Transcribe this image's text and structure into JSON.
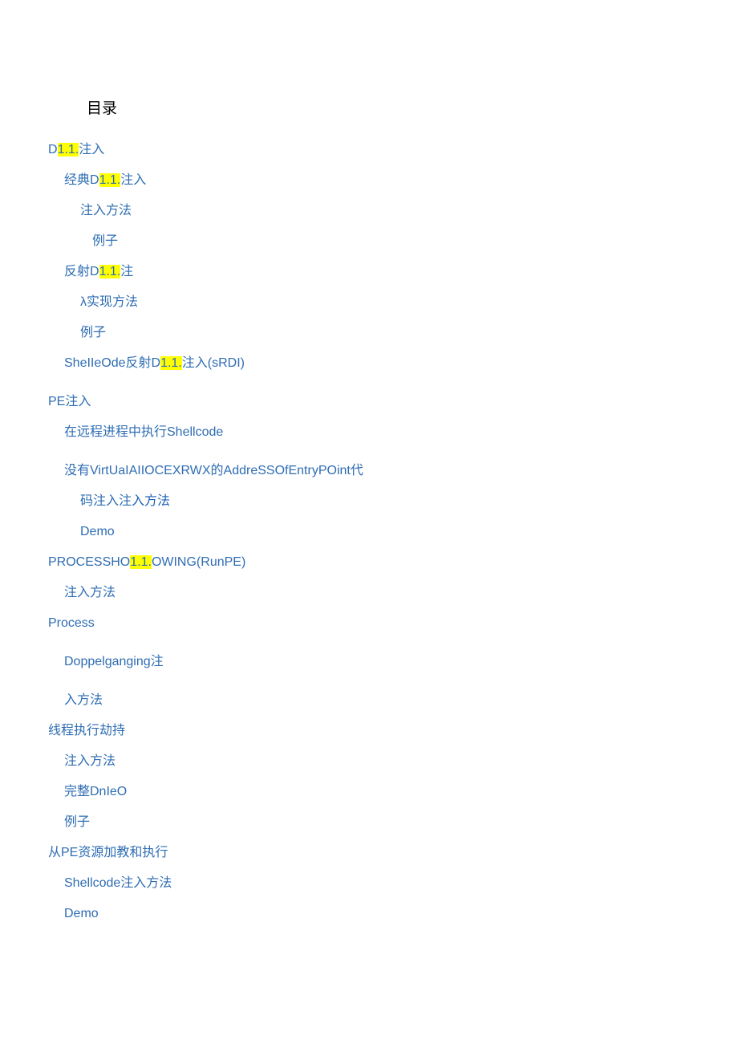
{
  "title": "目录",
  "toc": {
    "dll_injection": {
      "prefix": "D",
      "highlight": "1.1.",
      "suffix": "注入"
    },
    "classic_dll": {
      "prefix": "经典D",
      "highlight": "1.1.",
      "suffix": "注入"
    },
    "injection_method_1": "注入方法",
    "example_1": "例子",
    "reflective_dll": {
      "prefix": "反射D",
      "highlight": "1.1.",
      "suffix": "注"
    },
    "lambda_method": "λ实现方法",
    "example_2": "例子",
    "shellcode_reflective": {
      "prefix": "SheIIeOde反射D",
      "highlight": "1.1.",
      "suffix": "注入(sRDI)"
    },
    "pe_injection": "PE注入",
    "remote_shellcode": "在远程进程中执行Shellcode",
    "no_virtual_alloc": "没有VirtUaIAIIOCEXRWX的AddreSSOfEntryPOint代",
    "code_injection_method": {
      "part1": "码注入注",
      "part2": "入方法"
    },
    "demo_1": "Demo",
    "process_hollowing": {
      "prefix": "PROCESSHO",
      "highlight": "1.1.",
      "suffix": "OWING(RunPE)"
    },
    "injection_method_2": "注入方法",
    "process": "Process",
    "doppelganging": "Doppelganging注",
    "in_method": "入方法",
    "thread_hijack": "线程执行劫持",
    "injection_method_3": "注入方法",
    "complete_demo": "完整DnIeO",
    "example_3": "例子",
    "pe_resource": "从PE资源加教和执行",
    "shellcode_method": "Shellcode注入方法",
    "demo_2": "Demo"
  }
}
